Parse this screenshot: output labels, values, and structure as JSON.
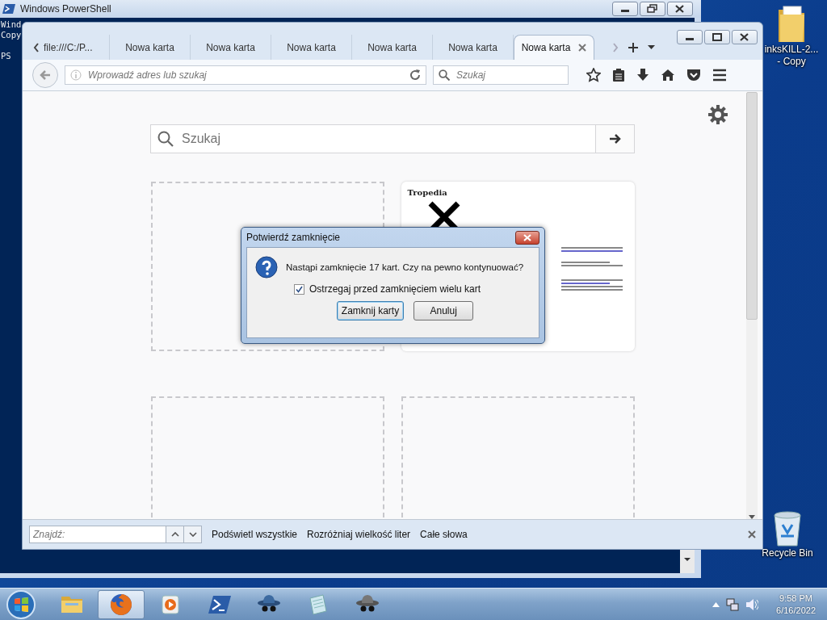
{
  "powershell": {
    "title": "Windows PowerShell",
    "lines": [
      "Wind",
      "Copy",
      "PS"
    ]
  },
  "desktop_icons": [
    {
      "kind": "folder",
      "lines": [
        "inksKILL-2...",
        "- Copy"
      ]
    },
    {
      "kind": "recycle",
      "lines": [
        "Recycle Bin"
      ]
    }
  ],
  "browser": {
    "tabs": [
      {
        "label": "file:///C:/P...",
        "selected": false
      },
      {
        "label": "Nowa karta",
        "selected": false
      },
      {
        "label": "Nowa karta",
        "selected": false
      },
      {
        "label": "Nowa karta",
        "selected": false
      },
      {
        "label": "Nowa karta",
        "selected": false
      },
      {
        "label": "Nowa karta",
        "selected": false
      },
      {
        "label": "Nowa karta",
        "selected": true
      }
    ],
    "address": {
      "placeholder": "Wprowadź adres lub szukaj"
    },
    "search": {
      "placeholder": "Szukaj"
    },
    "page_search": {
      "placeholder": "Szukaj"
    },
    "tiles": [
      {
        "kind": "empty"
      },
      {
        "kind": "thumbnail",
        "title": "Tropedia"
      },
      {
        "kind": "empty"
      },
      {
        "kind": "empty"
      }
    ],
    "find_bar": {
      "placeholder": "Znajdź:",
      "options": [
        "Podświetl wszystkie",
        "Rozróżniaj wielkość liter",
        "Całe słowa"
      ]
    }
  },
  "dialog": {
    "title": "Potwierdź zamknięcie",
    "message": "Nastąpi zamknięcie 17 kart. Czy na pewno kontynuować?",
    "checkbox": {
      "label": "Ostrzegaj przed zamknięciem wielu kart",
      "checked": true
    },
    "buttons": [
      {
        "label": "Zamknij karty",
        "default": true
      },
      {
        "label": "Anuluj",
        "default": false
      }
    ]
  },
  "taskbar": {
    "apps": [
      {
        "kind": "folder",
        "active": false
      },
      {
        "kind": "firefox",
        "active": true
      },
      {
        "kind": "media",
        "active": false
      },
      {
        "kind": "powershell",
        "active": false
      },
      {
        "kind": "hat",
        "active": false
      },
      {
        "kind": "notepad",
        "active": false
      },
      {
        "kind": "hat-grey",
        "active": false
      }
    ],
    "time": "9:58 PM",
    "date": "6/16/2022"
  }
}
